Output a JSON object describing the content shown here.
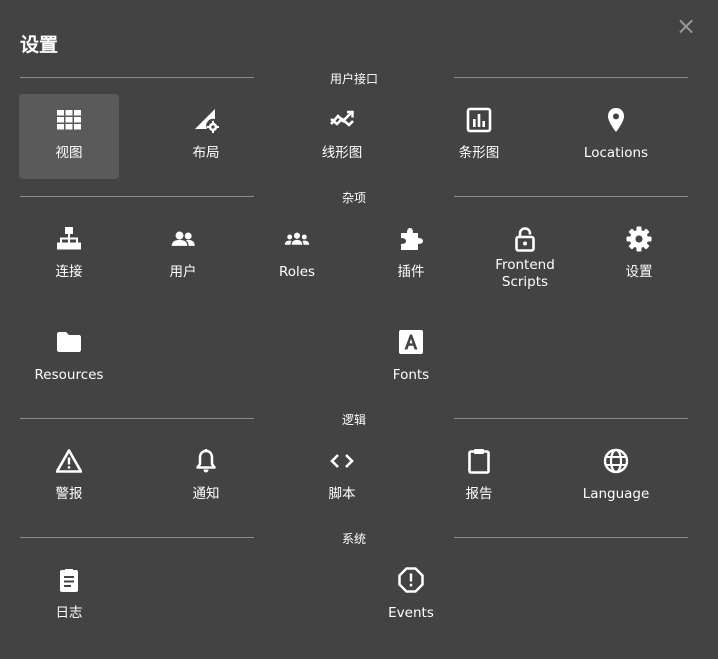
{
  "dialog": {
    "title": "设置",
    "close_glyph": "×"
  },
  "sections": {
    "ui": "用户接口",
    "misc": "杂项",
    "logic": "逻辑",
    "system": "系统"
  },
  "tiles": {
    "view": {
      "label": "视图",
      "icon": "grid-icon"
    },
    "layout": {
      "label": "布局",
      "icon": "layout-settings-icon"
    },
    "line_chart": {
      "label": "线形图",
      "icon": "trend-icon"
    },
    "bar_chart": {
      "label": "条形图",
      "icon": "bar-chart-icon"
    },
    "locations": {
      "label": "Locations",
      "icon": "map-pin-icon"
    },
    "connections": {
      "label": "连接",
      "icon": "sitemap-icon"
    },
    "users": {
      "label": "用户",
      "icon": "users-icon"
    },
    "roles": {
      "label": "Roles",
      "icon": "group-icon"
    },
    "plugins": {
      "label": "插件",
      "icon": "puzzle-icon"
    },
    "frontend_scripts": {
      "label_line1": "Frontend",
      "label_line2": "Scripts",
      "icon": "unlock-icon"
    },
    "settings": {
      "label": "设置",
      "icon": "gear-icon"
    },
    "resources": {
      "label": "Resources",
      "icon": "folder-icon"
    },
    "fonts": {
      "label": "Fonts",
      "icon": "font-icon"
    },
    "alerts": {
      "label": "警报",
      "icon": "warning-icon"
    },
    "notifications": {
      "label": "通知",
      "icon": "bell-icon"
    },
    "scripts": {
      "label": "脚本",
      "icon": "code-icon"
    },
    "reports": {
      "label": "报告",
      "icon": "clipboard-icon"
    },
    "language": {
      "label": "Language",
      "icon": "globe-icon"
    },
    "logs": {
      "label": "日志",
      "icon": "clipboard-list-icon"
    },
    "events": {
      "label": "Events",
      "icon": "exclamation-circle-icon"
    }
  }
}
